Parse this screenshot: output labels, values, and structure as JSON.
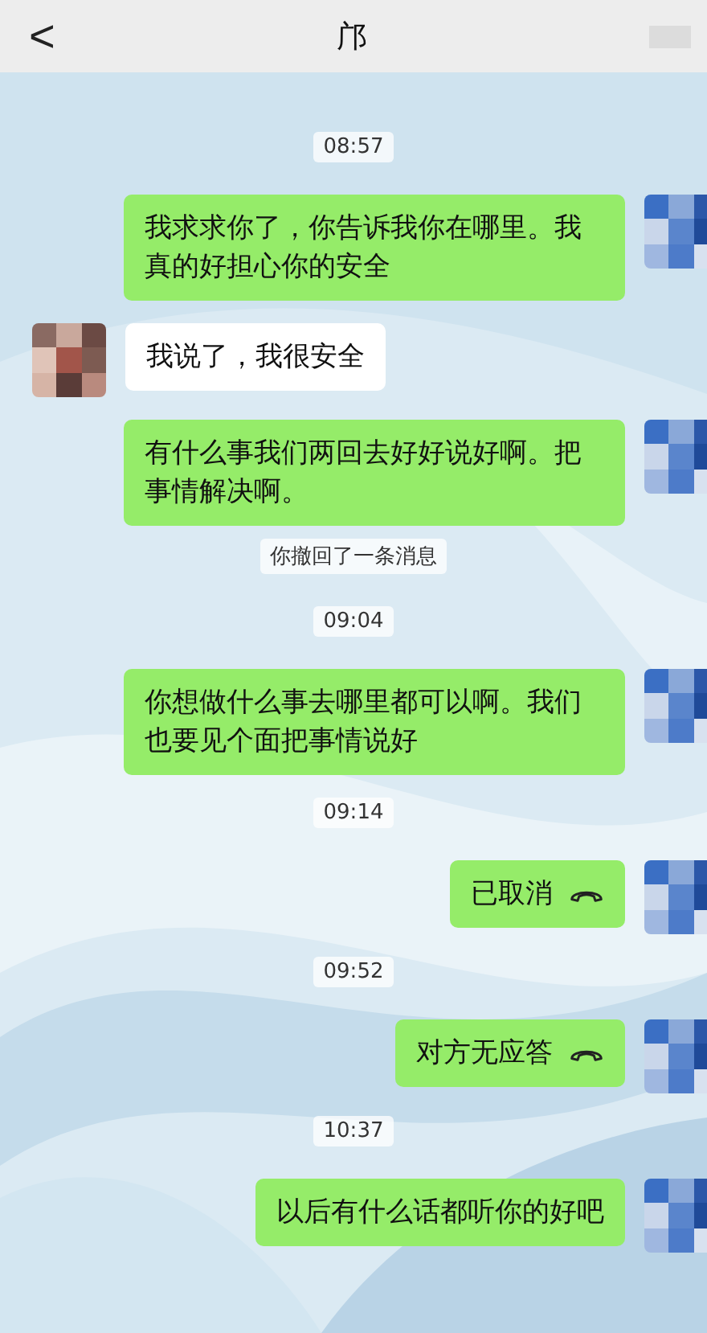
{
  "header": {
    "back": "<",
    "title": "邝"
  },
  "messages": [
    {
      "kind": "time",
      "text": "08:57"
    },
    {
      "kind": "sent",
      "text": "我求求你了，你告诉我你在哪里。我真的好担心你的安全"
    },
    {
      "kind": "received",
      "text": "我说了，我很安全"
    },
    {
      "kind": "sent",
      "text": "有什么事我们两回去好好说好啊。把事情解决啊。"
    },
    {
      "kind": "notice",
      "text": "你撤回了一条消息"
    },
    {
      "kind": "time",
      "text": "09:04"
    },
    {
      "kind": "sent",
      "text": "你想做什么事去哪里都可以啊。我们也要见个面把事情说好"
    },
    {
      "kind": "time",
      "text": "09:14"
    },
    {
      "kind": "call",
      "text": "已取消"
    },
    {
      "kind": "time",
      "text": "09:52"
    },
    {
      "kind": "call",
      "text": "对方无应答"
    },
    {
      "kind": "time",
      "text": "10:37"
    },
    {
      "kind": "sent",
      "text": "以后有什么话都听你的好吧"
    }
  ]
}
